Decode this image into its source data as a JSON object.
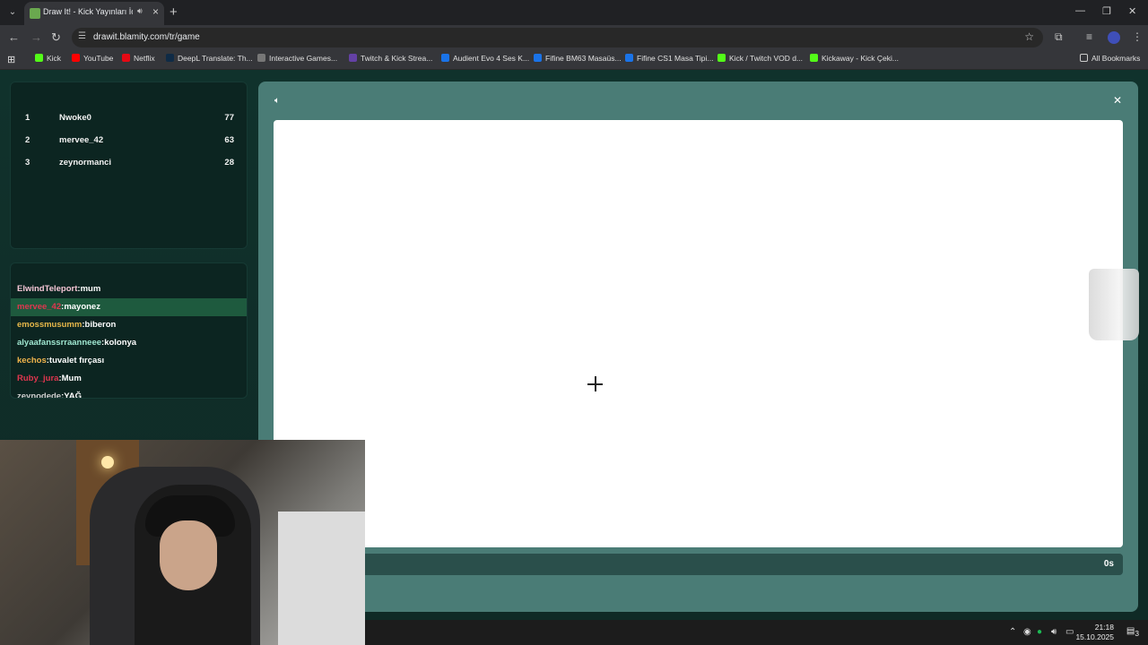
{
  "browser": {
    "tab_title": "Draw It! - Kick Yayınları İçin",
    "url": "drawit.blamity.com/tr/game",
    "bookmarks": [
      "Kick",
      "YouTube",
      "Netflix",
      "DeepL Translate: Th...",
      "Interactive Games...",
      "Twitch & Kick Strea...",
      "Audient Evo 4 Ses K...",
      "Fifine BM63 Masaüs...",
      "Fifine CS1 Masa Tipi...",
      "Kick / Twitch VOD d...",
      "Kickaway - Kick Çeki..."
    ],
    "all_bookmarks": "All Bookmarks"
  },
  "leaderboard": [
    {
      "rank": "1",
      "name": "Nwoke0",
      "score": "77"
    },
    {
      "rank": "2",
      "name": "mervee_42",
      "score": "63"
    },
    {
      "rank": "3",
      "name": "zeynormanci",
      "score": "28"
    }
  ],
  "chat": [
    {
      "user": "ElwindTeleport",
      "message": "mum",
      "user_color": "#f5c6d6"
    },
    {
      "user": "mervee_42",
      "message": "mayonez",
      "user_color": "#e0364f"
    },
    {
      "user": "emossmusumm",
      "message": "biberon",
      "user_color": "#e8b84a"
    },
    {
      "user": "alyaafanssrraanneee",
      "message": "kolonya",
      "user_color": "#9fe6d0"
    },
    {
      "user": "kechos",
      "message": "tuvalet fırçası",
      "user_color": "#f0b44c"
    },
    {
      "user": "Ruby_jura",
      "message": "Mum",
      "user_color": "#e0364f"
    },
    {
      "user": "zeynodede",
      "message": "YAĞ",
      "user_color": "#cfcfcf"
    }
  ],
  "game": {
    "timer": "0s",
    "sound_icon": "speaker-icon",
    "close_icon": "close-icon"
  },
  "taskbar": {
    "time": "21:18",
    "date": "15.10.2025",
    "notifications": "3"
  },
  "colors": {
    "page_bg": "#0f2a26",
    "panel_bg": "#4a7c76",
    "highlight_row": "#1e5a3e"
  }
}
